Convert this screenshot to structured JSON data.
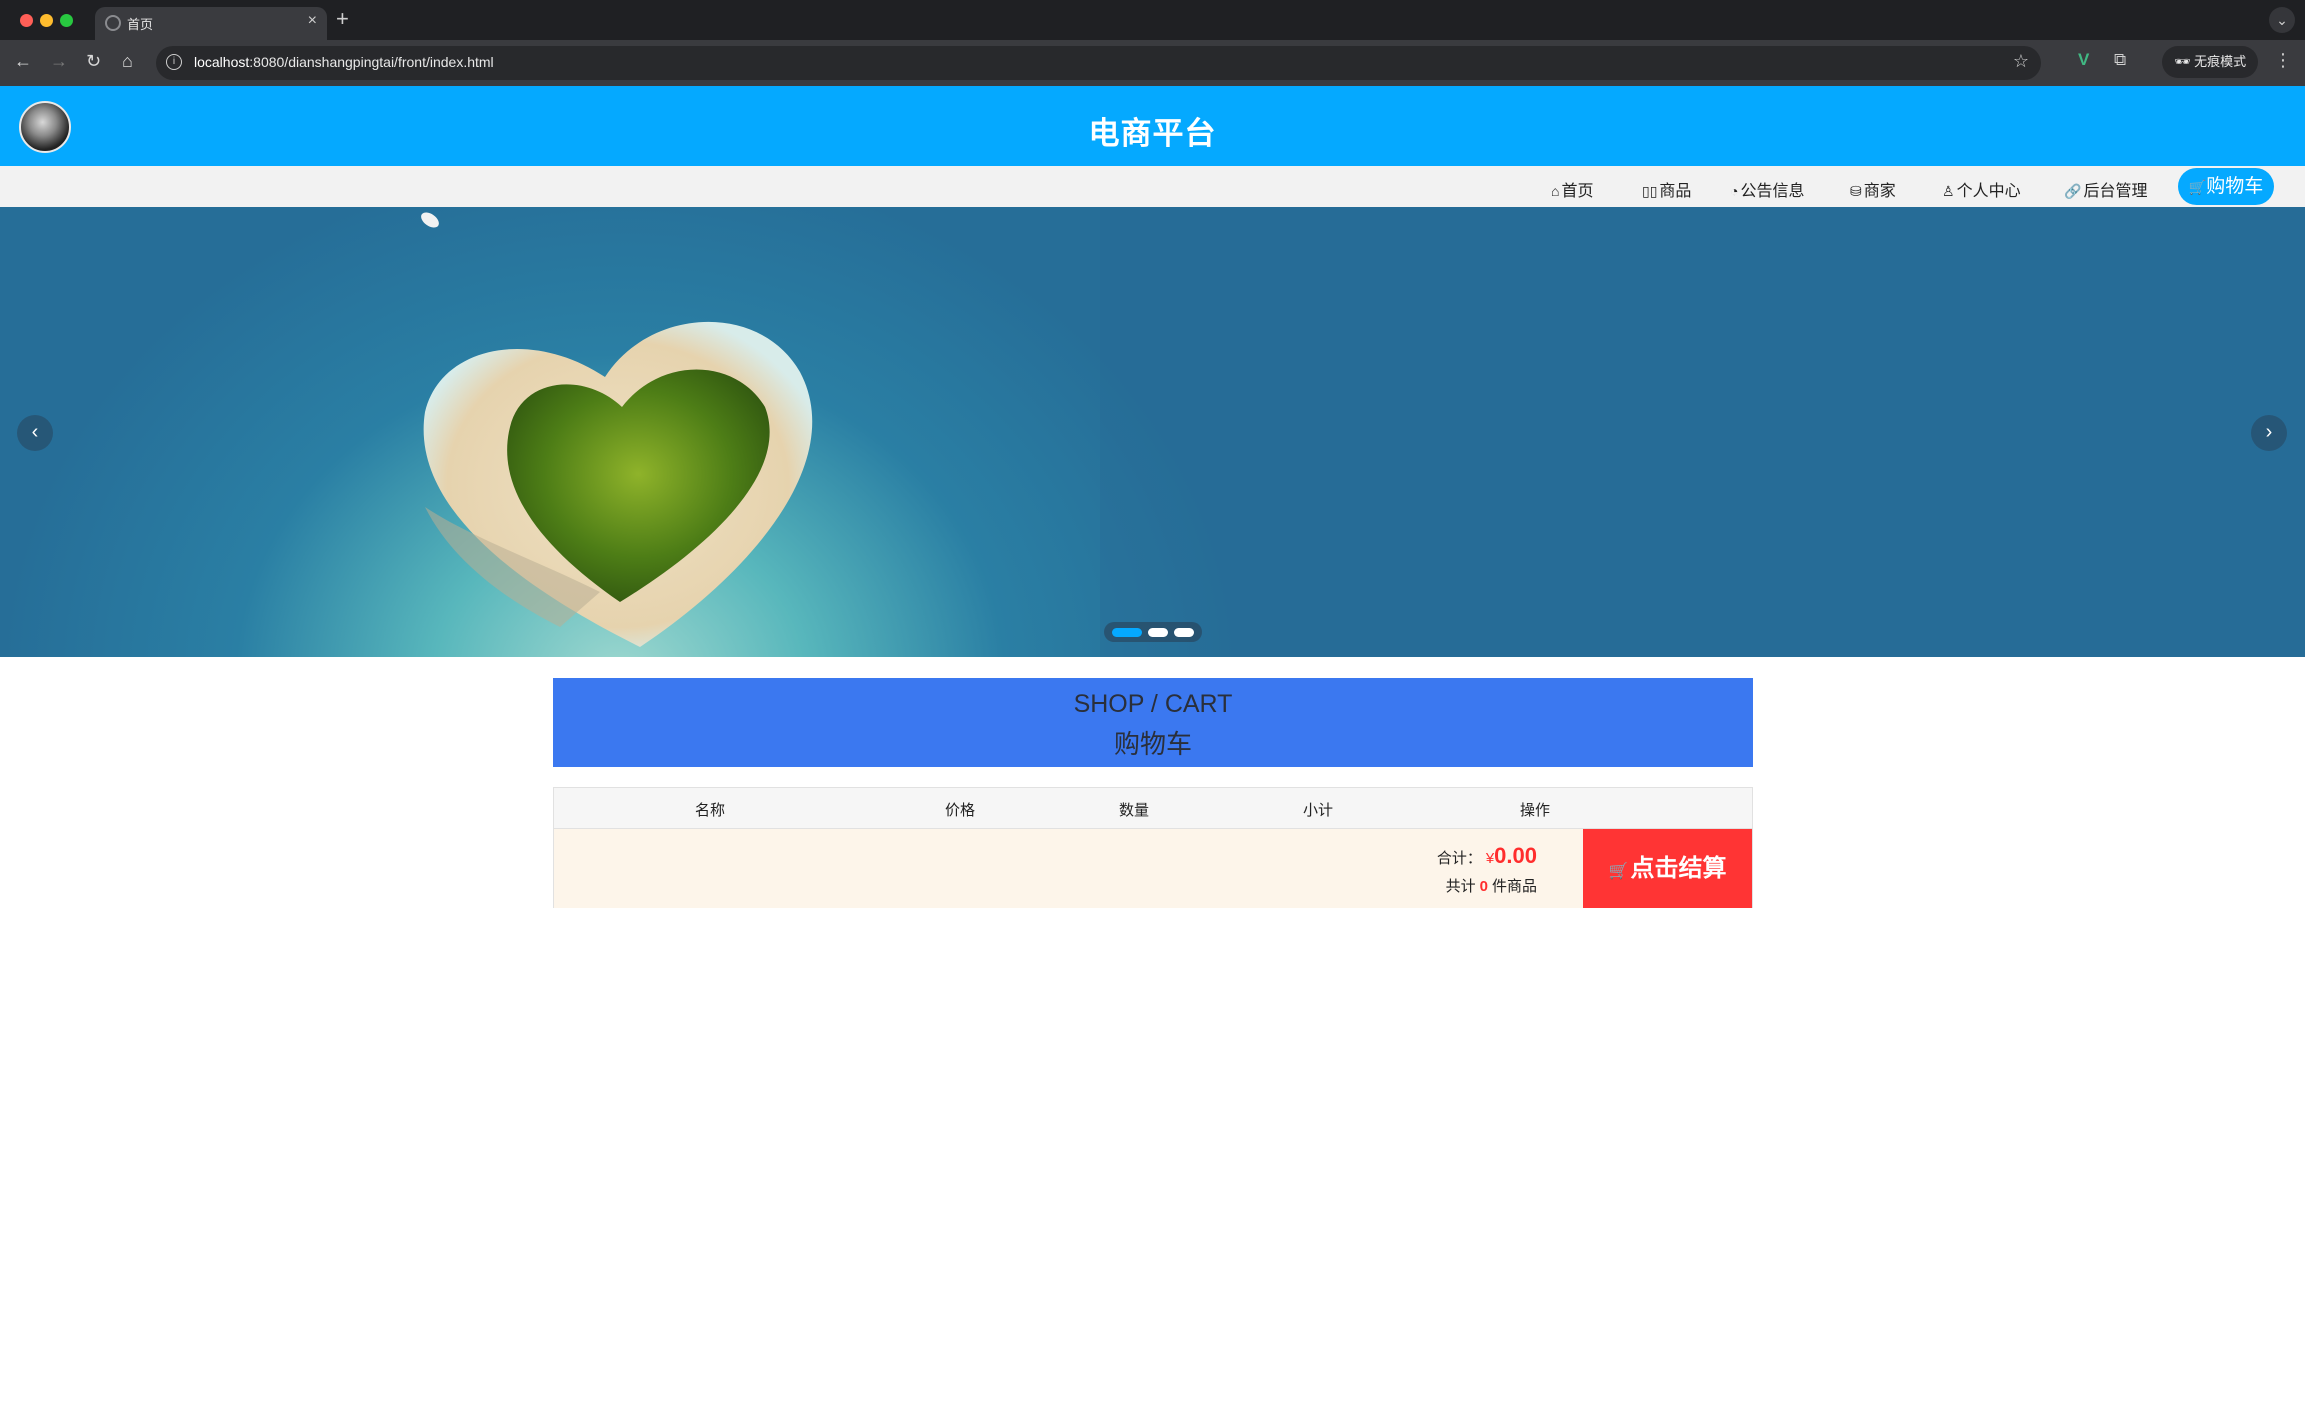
{
  "browser": {
    "tab_title": "首页",
    "tab_close": "×",
    "new_tab": "+",
    "tabs_menu": "⌄",
    "url_host": "localhost",
    "url_rest": ":8080/dianshangpingtai/front/index.html",
    "incognito_label": "无痕模式"
  },
  "site": {
    "title": "电商平台"
  },
  "menu": {
    "items": [
      {
        "icon": "⌂",
        "label": "首页"
      },
      {
        "icon": "▯▯",
        "label": "商品"
      },
      {
        "icon": "◔",
        "label": "公告信息"
      },
      {
        "icon": "⛁",
        "label": "商家"
      },
      {
        "icon": "♙",
        "label": "个人中心"
      },
      {
        "icon": "🔗",
        "label": "后台管理"
      }
    ],
    "cart": {
      "icon": "🛒",
      "label": "购物车"
    }
  },
  "carousel": {
    "prev": "‹",
    "next": "›",
    "slide_count": 3,
    "active_index": 0,
    "accent": "#05a9ff"
  },
  "section": {
    "title_en": "SHOP / CART",
    "title_zh": "购物车"
  },
  "cart": {
    "columns": [
      "名称",
      "价格",
      "数量",
      "小计",
      "操作"
    ],
    "total_label": "合计：",
    "currency": "¥",
    "total_amount": "0.00",
    "count_prefix": "共计",
    "count": "0",
    "count_suffix": "件商品",
    "checkout_label": "点击结算",
    "checkout_icon": "🛒"
  },
  "colors": {
    "header": "#05a9ff",
    "section": "#3b78f0",
    "checkout": "#ff3434",
    "price": "#ff2d2d"
  }
}
